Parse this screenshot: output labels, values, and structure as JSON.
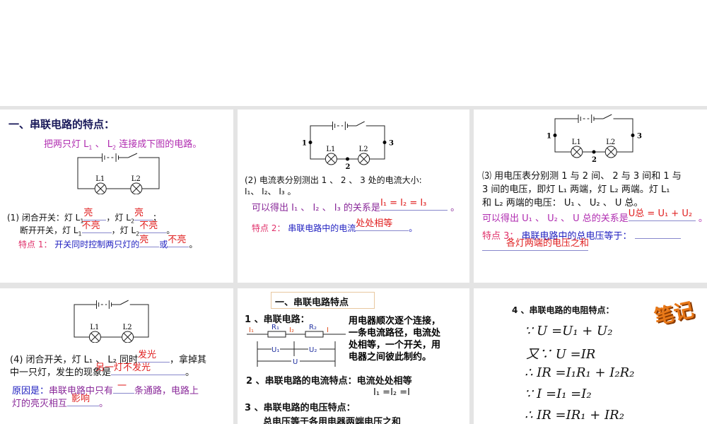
{
  "p1": {
    "title": "一、串联电路的特点：",
    "sub_a": "把两只灯 L",
    "sub_b": "、 L",
    "sub_c": "连接成下图的电路。",
    "l1a": "(1) 闭合开关：灯 L",
    "l1b": "，灯 L",
    "l1c": "；",
    "ans1": "亮",
    "ans2": "亮",
    "l2a": "断开开关，灯 L",
    "l2b": "，灯 L",
    "l2c": "。",
    "ans3": "不亮",
    "ans4": "不亮",
    "f_label": "特点 1：",
    "f_text": "开关同时控制两只灯的",
    "f_or": "或",
    "f_end": "。",
    "ans5": "亮",
    "ans6": "不亮"
  },
  "p2": {
    "q": "(2) 电流表分别测出 1 、 2 、 3 处的电流大小:",
    "q2": "I₁、 I₂、 I₃ 。",
    "rel": "可以得出 I₁ 、 I₂ 、 I₃ 的关系是",
    "ans_rel": "I₁ = I₂ = I₃",
    "end": "。",
    "f_label": "特点 2：",
    "f_text": "串联电路中的电流",
    "ans_f": "处处相等"
  },
  "p3": {
    "q1": "⑶ 用电压表分别测 1 与 2 间、 2 与 3 间和 1 与",
    "q2": "3 间的电压，即灯 L₁ 两端，灯 L₂ 两端。灯 L₁",
    "q3": "和 L₂ 两端的电压： U₁ 、 U₂ 、 U 总。",
    "rel": "可以得出 U₁ 、 U₂ 、 U 总的关系是",
    "ans_rel": "U总 = U₁ + U₂",
    "end": "。",
    "f_label": "特点 3：",
    "f_text": "串联电路中的总电压等于：",
    "ans_f": "各灯两端的电压之和"
  },
  "p4": {
    "q1a": "(4) 闭合开关，灯 L₁ 、 L₂ 同时",
    "ans1": "发光",
    "q1b": "，拿掉其",
    "q2a": "中一只灯，发生的现象是",
    "ans2": "另一灯不发光",
    "q2b": "。",
    "r_label": "原因是：",
    "r_text": "串联电路中只有",
    "ans3": "一",
    "r_text2": "条通路，电路上",
    "r3": "灯的亮灭相互",
    "ans4": "影响",
    "r_end": "。"
  },
  "p5": {
    "header": "一、串联电路特点",
    "s1": "1 、串联电路：",
    "desc": [
      "用电器顺次逐个连接，",
      "一条电流路径，电流处",
      "处相等，一个开关，用",
      "电器之间彼此制约。"
    ],
    "s2": "2 、串联电路的电流特点：电流处处相等",
    "eq": "I₁ =I₂ =I",
    "s3": "3 、串联电路的电压特点：",
    "s3b": "总电压等于各用电器两端电压之和",
    "diagram": {
      "i1": "I₁",
      "r1": "R₁",
      "i2": "I₂",
      "r2": "R₂",
      "i": "I",
      "u1": "U₁",
      "u2": "U₂",
      "u": "U"
    }
  },
  "p6": {
    "s4": "4 、串联电路的电阻特点：",
    "formulas": [
      "∵ U =U₁ + U₂",
      "又∵ U =IR",
      "∴ IR =I₁R₁ + I₂R₂",
      "∵ I =I₁ =I₂",
      "∴ IR =IR₁ + IR₂"
    ],
    "badge": "笔记"
  },
  "circuit": {
    "lamp1": "L1",
    "lamp2": "L2",
    "p1": "1",
    "p2": "2",
    "p3": "3"
  }
}
